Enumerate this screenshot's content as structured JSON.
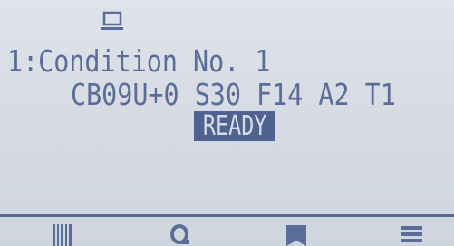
{
  "screen": {
    "status_icon": "pc-connection-icon",
    "condition_line": "1:Condition No. 1",
    "settings_line": "CB09U+0 S30 F14 A2 T1",
    "status": "READY"
  },
  "softkeys": [
    {
      "icon": "barcode-icon"
    },
    {
      "icon": "search-icon"
    },
    {
      "icon": "bookmark-icon"
    },
    {
      "icon": "menu-icon"
    }
  ],
  "colors": {
    "lcd_background": "#d5dae2",
    "lcd_foreground": "#5a6d98",
    "highlight_background": "#4f6290",
    "highlight_text": "#d6dbe4"
  }
}
